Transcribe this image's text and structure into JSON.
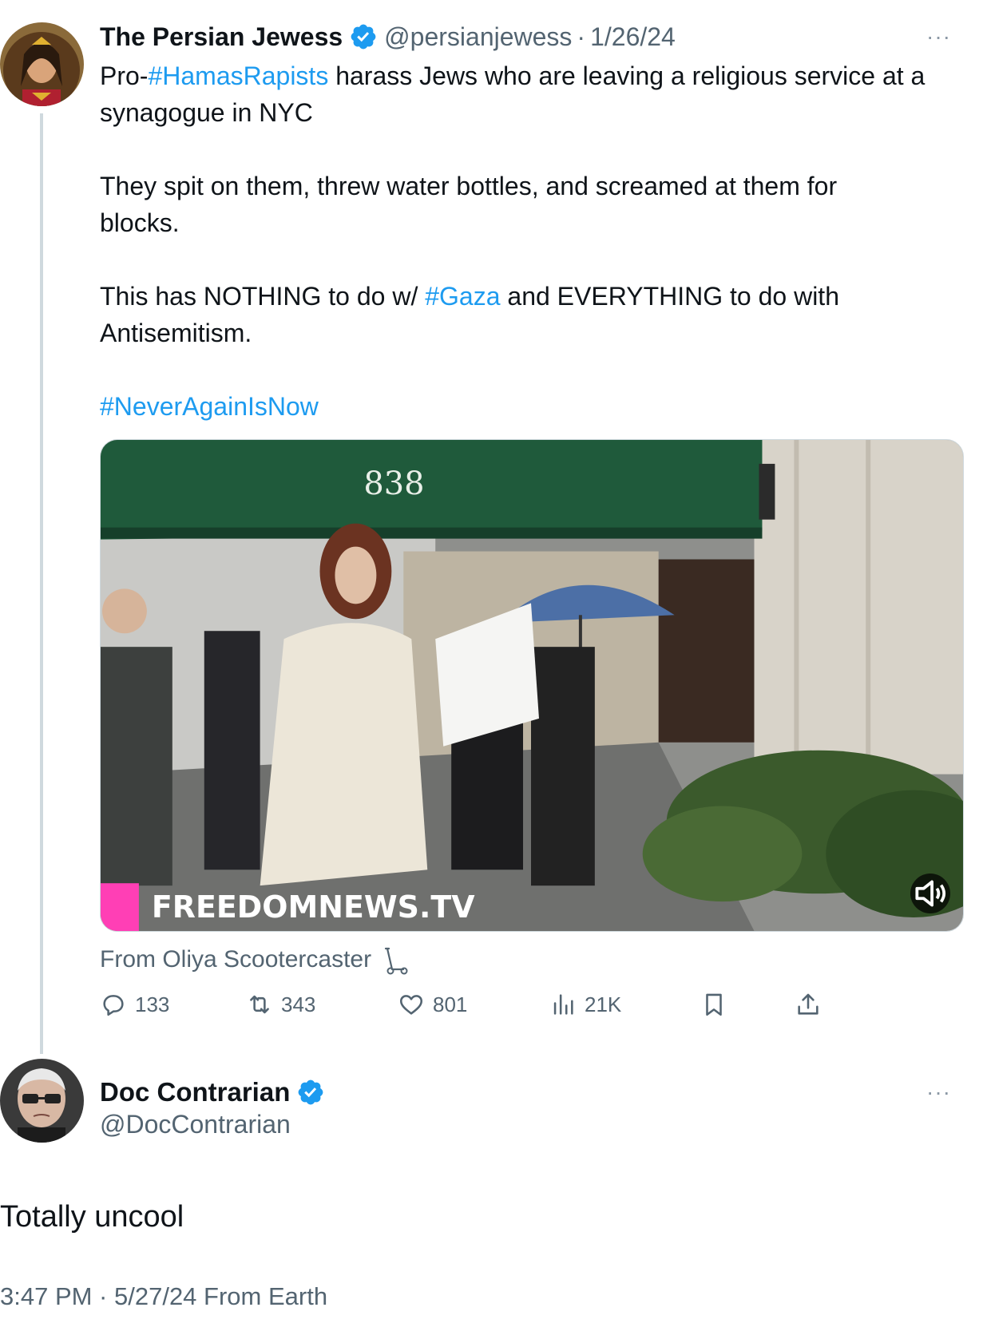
{
  "tweet": {
    "author_name": "The Persian Jewess",
    "handle": "@persianjewess",
    "separator": "·",
    "date": "1/26/24",
    "more": "···",
    "line1_prefix": "Pro-",
    "line1_hashtag": "#HamasRapists",
    "line1_rest": " harass Jews who are leaving a religious service at a",
    "line2": "synagogue in NYC",
    "line3": "They spit on them, threw water bottles, and screamed at them for",
    "line4": "blocks.",
    "line5_prefix": "This has NOTHING to do w/ ",
    "line5_hashtag": "#Gaza",
    "line5_rest": " and EVERYTHING to do with",
    "line6": "Antisemitism.",
    "closing_hashtag": "#NeverAgainIsNow",
    "media": {
      "awning_number": "838",
      "watermark": "FREEDOMNEWS.TV"
    },
    "from_source": "From Oliya Scootercaster",
    "stats": {
      "replies": "133",
      "reposts": "343",
      "likes": "801",
      "views": "21K"
    }
  },
  "reply": {
    "author_name": "Doc Contrarian",
    "handle": "@DocContrarian",
    "more": "···",
    "text": "Totally uncool",
    "meta": "3:47 PM · 5/27/24 From Earth"
  },
  "colors": {
    "link": "#1d9bf0",
    "secondary_text": "#536471",
    "verified": "#1d9bf0",
    "thread_line": "#cfd9de"
  },
  "icons": [
    "verified-badge-icon",
    "more-icon",
    "scooter-icon",
    "reply-icon",
    "repost-icon",
    "like-icon",
    "views-icon",
    "bookmark-icon",
    "share-icon",
    "volume-icon"
  ]
}
